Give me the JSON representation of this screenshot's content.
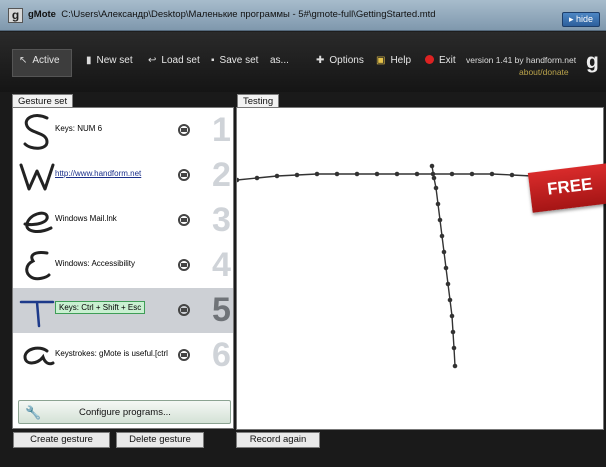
{
  "window": {
    "app_name": "gMote",
    "path": "C:\\Users\\Александр\\Desktop\\Маленькие программы - 5#\\gmote-full\\GettingStarted.mtd",
    "hide_label": "hide"
  },
  "toolbar": {
    "active_label": "Active",
    "new_set_label": "New set",
    "load_set_label": "Load set",
    "save_set_label": "Save set",
    "save_as_label": "as...",
    "options_label": "Options",
    "help_label": "Help",
    "exit_label": "Exit",
    "version_text": "version 1.41 by handform.net",
    "donate_label": "about/donate",
    "logo": "g"
  },
  "gesture_panel": {
    "title": "Gesture set",
    "gestures": [
      {
        "letter": "S",
        "label": "Keys: NUM 6",
        "number": "1",
        "style": "plain"
      },
      {
        "letter": "W",
        "label": "http://www.handform.net",
        "number": "2",
        "style": "link"
      },
      {
        "letter": "e",
        "label": "Windows Mail.lnk",
        "number": "3",
        "style": "plain"
      },
      {
        "letter": "E",
        "label": "Windows: Accessibility",
        "number": "4",
        "style": "plain"
      },
      {
        "letter": "T",
        "label": "Keys: Ctrl + Shift + Esc",
        "number": "5",
        "style": "boxed",
        "selected": true
      },
      {
        "letter": "a",
        "label": "Keystrokes: gMote is useful.[ctrl",
        "number": "6",
        "style": "plain"
      }
    ],
    "configure_label": "Configure programs...",
    "create_label": "Create gesture",
    "delete_label": "Delete gesture"
  },
  "testing_panel": {
    "title": "Testing",
    "record_again_label": "Record again"
  },
  "badge": {
    "free_label": "FREE"
  },
  "colors": {
    "toolbar_bg": "#1e1e1e",
    "selected_row": "#cdd0d5",
    "accent_green": "#c9f0d1",
    "free_red": "#c41f1f"
  }
}
